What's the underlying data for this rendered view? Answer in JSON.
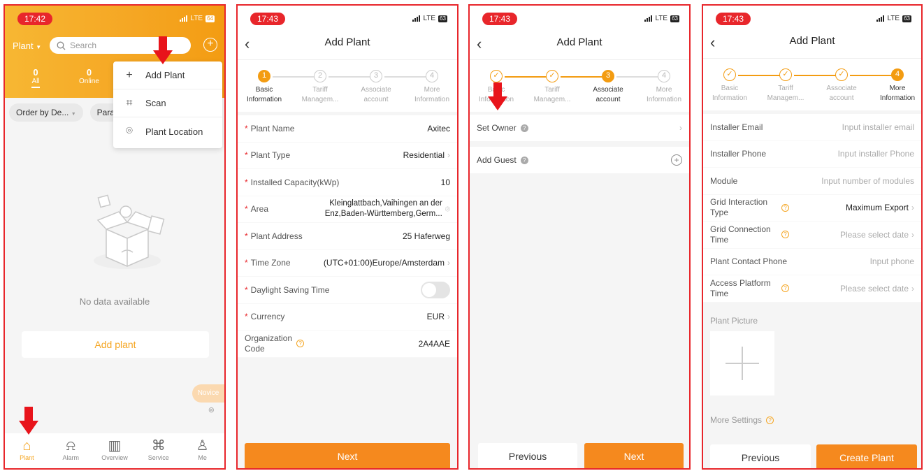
{
  "p1": {
    "time": "17:42",
    "network": "LTE",
    "battery": "64",
    "plant_dropdown": "Plant",
    "search_placeholder": "Search",
    "stats": [
      {
        "num": "0",
        "label": "All"
      },
      {
        "num": "0",
        "label": "Online"
      }
    ],
    "filters": [
      "Order by De...",
      "Para"
    ],
    "popup": [
      {
        "icon": "plus-icon",
        "label": "Add Plant"
      },
      {
        "icon": "scan-icon",
        "label": "Scan"
      },
      {
        "icon": "location-icon",
        "label": "Plant Location"
      }
    ],
    "empty_text": "No data available",
    "add_plant": "Add plant",
    "novice": "Novice",
    "tabs": [
      {
        "icon": "home-icon",
        "label": "Plant"
      },
      {
        "icon": "alarm-icon",
        "label": "Alarm"
      },
      {
        "icon": "overview-icon",
        "label": "Overview"
      },
      {
        "icon": "service-icon",
        "label": "Service"
      },
      {
        "icon": "user-icon",
        "label": "Me"
      }
    ]
  },
  "common": {
    "title": "Add Plant",
    "steps": [
      {
        "num": "1",
        "label1": "Basic",
        "label2": "Information"
      },
      {
        "num": "2",
        "label1": "Tariff",
        "label2": "Managem..."
      },
      {
        "num": "3",
        "label1": "Associate",
        "label2": "account"
      },
      {
        "num": "4",
        "label1": "More",
        "label2": "Information"
      }
    ]
  },
  "p2": {
    "time": "17:43",
    "network": "LTE",
    "battery": "63",
    "fields": [
      {
        "label": "Plant Name",
        "value": "Axitec"
      },
      {
        "label": "Plant Type",
        "value": "Residential"
      },
      {
        "label": "Installed Capacity(kWp)",
        "value": "10"
      },
      {
        "label": "Area",
        "value": "Kleinglattbach,Vaihingen an der Enz,Baden-Württemberg,Germ..."
      },
      {
        "label": "Plant Address",
        "value": "25 Haferweg"
      },
      {
        "label": "Time Zone",
        "value": "(UTC+01:00)Europe/Amsterdam"
      },
      {
        "label": "Daylight Saving Time",
        "value": ""
      },
      {
        "label": "Currency",
        "value": "EUR"
      },
      {
        "label1": "Organization",
        "label2": "Code",
        "value": "2A4AAE"
      }
    ],
    "next": "Next"
  },
  "p3": {
    "time": "17:43",
    "network": "LTE",
    "battery": "63",
    "set_owner": "Set Owner",
    "add_guest": "Add Guest",
    "previous": "Previous",
    "next": "Next"
  },
  "p4": {
    "time": "17:43",
    "network": "LTE",
    "battery": "63",
    "fields": [
      {
        "label": "Installer Email",
        "placeholder": "Input installer email"
      },
      {
        "label": "Installer Phone",
        "placeholder": "Input installer Phone"
      },
      {
        "label": "Module",
        "placeholder": "Input number of modules"
      },
      {
        "label1": "Grid Interaction",
        "label2": "Type",
        "value": "Maximum Export"
      },
      {
        "label1": "Grid Connection",
        "label2": "Time",
        "placeholder": "Please select date"
      },
      {
        "label": "Plant Contact Phone",
        "placeholder": "Input phone"
      },
      {
        "label1": "Access Platform",
        "label2": "Time",
        "placeholder": "Please select date"
      }
    ],
    "plant_picture": "Plant Picture",
    "more_settings": "More Settings",
    "previous": "Previous",
    "create": "Create Plant"
  }
}
